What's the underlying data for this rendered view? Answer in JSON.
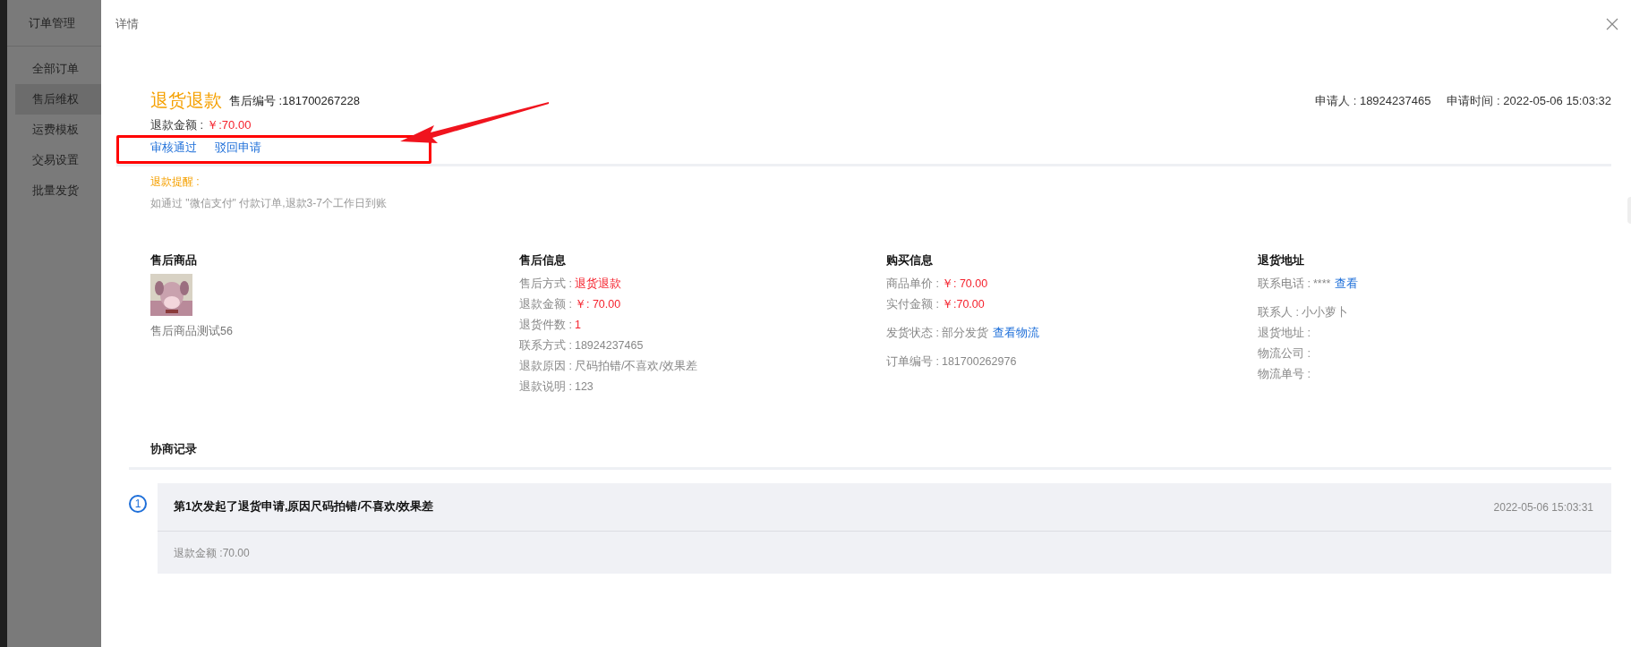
{
  "sidebar": {
    "title": "订单管理",
    "items": [
      {
        "label": "全部订单",
        "selected": false
      },
      {
        "label": "售后维权",
        "selected": true
      },
      {
        "label": "运费模板",
        "selected": false
      },
      {
        "label": "交易设置",
        "selected": false
      },
      {
        "label": "批量发货",
        "selected": false
      }
    ]
  },
  "drawer": {
    "title": "详情"
  },
  "header": {
    "type": "退货退款",
    "service_no": "售后编号 :181700267228",
    "refund_label": "退款金额 :",
    "refund_value": "￥:70.00",
    "actions": [
      "审核通过",
      "驳回申请"
    ],
    "applicant": "申请人 : 18924237465",
    "apply_time": "申请时间 : 2022-05-06 15:03:32"
  },
  "reminder": {
    "title": "退款提醒 :",
    "text": "如通过 \"微信支付\" 付款订单,退款3-7个工作日到账"
  },
  "columns": [
    {
      "kind": "product",
      "heading": "售后商品",
      "name": "售后商品测试56"
    },
    {
      "kind": "fields",
      "heading": "售后信息",
      "groups": [
        [
          {
            "label": "售后方式 :",
            "value": "退货退款",
            "emphasis": true
          },
          {
            "label": "退款金额 :",
            "value": "￥: 70.00",
            "emphasis": true
          },
          {
            "label": "退货件数 :",
            "value": "1",
            "emphasis": true
          },
          {
            "label": "联系方式 :",
            "value": "18924237465",
            "emphasis": false
          },
          {
            "label": "退款原因 :",
            "value": "尺码拍错/不喜欢/效果差",
            "emphasis": false
          },
          {
            "label": "退款说明 :",
            "value": "123",
            "emphasis": false
          }
        ]
      ]
    },
    {
      "kind": "fields",
      "heading": "购买信息",
      "groups": [
        [
          {
            "label": "商品单价 :",
            "value": "￥: 70.00",
            "emphasis": true
          },
          {
            "label": "实付金额 :",
            "value": "￥:70.00",
            "emphasis": true
          }
        ],
        [
          {
            "label": "发货状态 :",
            "value": "部分发货",
            "emphasis": false,
            "link": "查看物流"
          }
        ],
        [
          {
            "label": "订单编号 :",
            "value": "181700262976",
            "emphasis": false
          }
        ]
      ]
    },
    {
      "kind": "fields",
      "heading": "退货地址",
      "groups": [
        [
          {
            "label": "联系电话 :",
            "value": "****",
            "emphasis": false,
            "link": "查看"
          }
        ],
        [
          {
            "label": "联系人 :",
            "value": "小小萝卜",
            "emphasis": false
          },
          {
            "label": "退货地址 :",
            "emphasis": false
          },
          {
            "label": "物流公司 :",
            "emphasis": false
          },
          {
            "label": "物流单号 :",
            "emphasis": false
          }
        ]
      ]
    }
  ],
  "negotiation": {
    "title": "协商记录",
    "records": [
      {
        "index": "1",
        "title": "第1次发起了退货申请,原因尺码拍错/不喜欢/效果差",
        "time": "2022-05-06 15:03:31",
        "detail": "退款金额 :70.00"
      }
    ]
  }
}
